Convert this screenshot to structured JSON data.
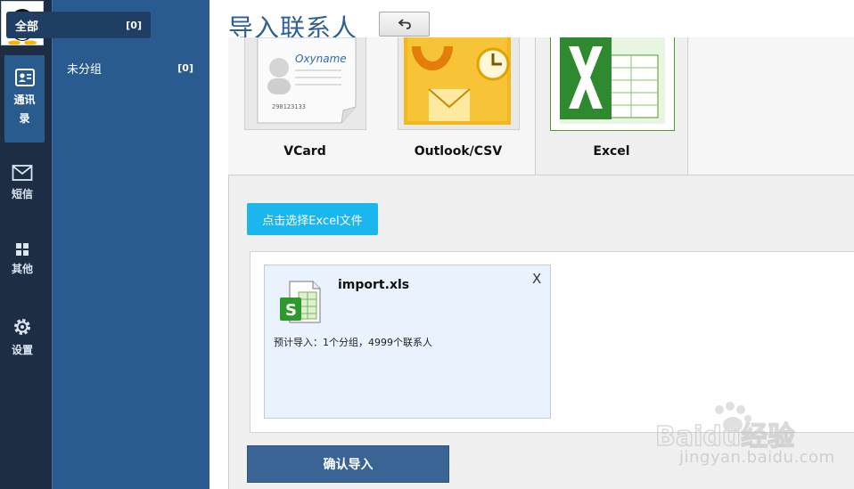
{
  "nav": {
    "items": [
      {
        "label": "通讯录",
        "icon": "contacts-card-icon",
        "active": true
      },
      {
        "label": "短信",
        "icon": "mail-envelope-icon"
      },
      {
        "label": "其他",
        "icon": "grid-icon"
      },
      {
        "label": "设置",
        "icon": "gear-icon"
      }
    ]
  },
  "groups": [
    {
      "name": "全部",
      "count": "[0]"
    },
    {
      "name": "未分组",
      "count": "[0]"
    }
  ],
  "header": {
    "title": "导入联系人"
  },
  "tabs": [
    {
      "label": "VCard",
      "tile_text": "Oxyname",
      "tile_number": "298123133"
    },
    {
      "label": "Outlook/CSV"
    },
    {
      "label": "Excel"
    }
  ],
  "upload": {
    "choose_label": "点击选择Excel文件"
  },
  "file": {
    "name": "import.xls",
    "close": "X",
    "summary": "预计导入：1个分组，4999个联系人"
  },
  "confirm_label": "确认导入",
  "watermark": {
    "brand": "Baidu经验",
    "url": "jingyan.baidu.com"
  },
  "colors": {
    "accent": "#1bb6ee",
    "sidebar": "#2a5b90",
    "rail": "#1c2d44",
    "confirm": "#3a6494"
  }
}
